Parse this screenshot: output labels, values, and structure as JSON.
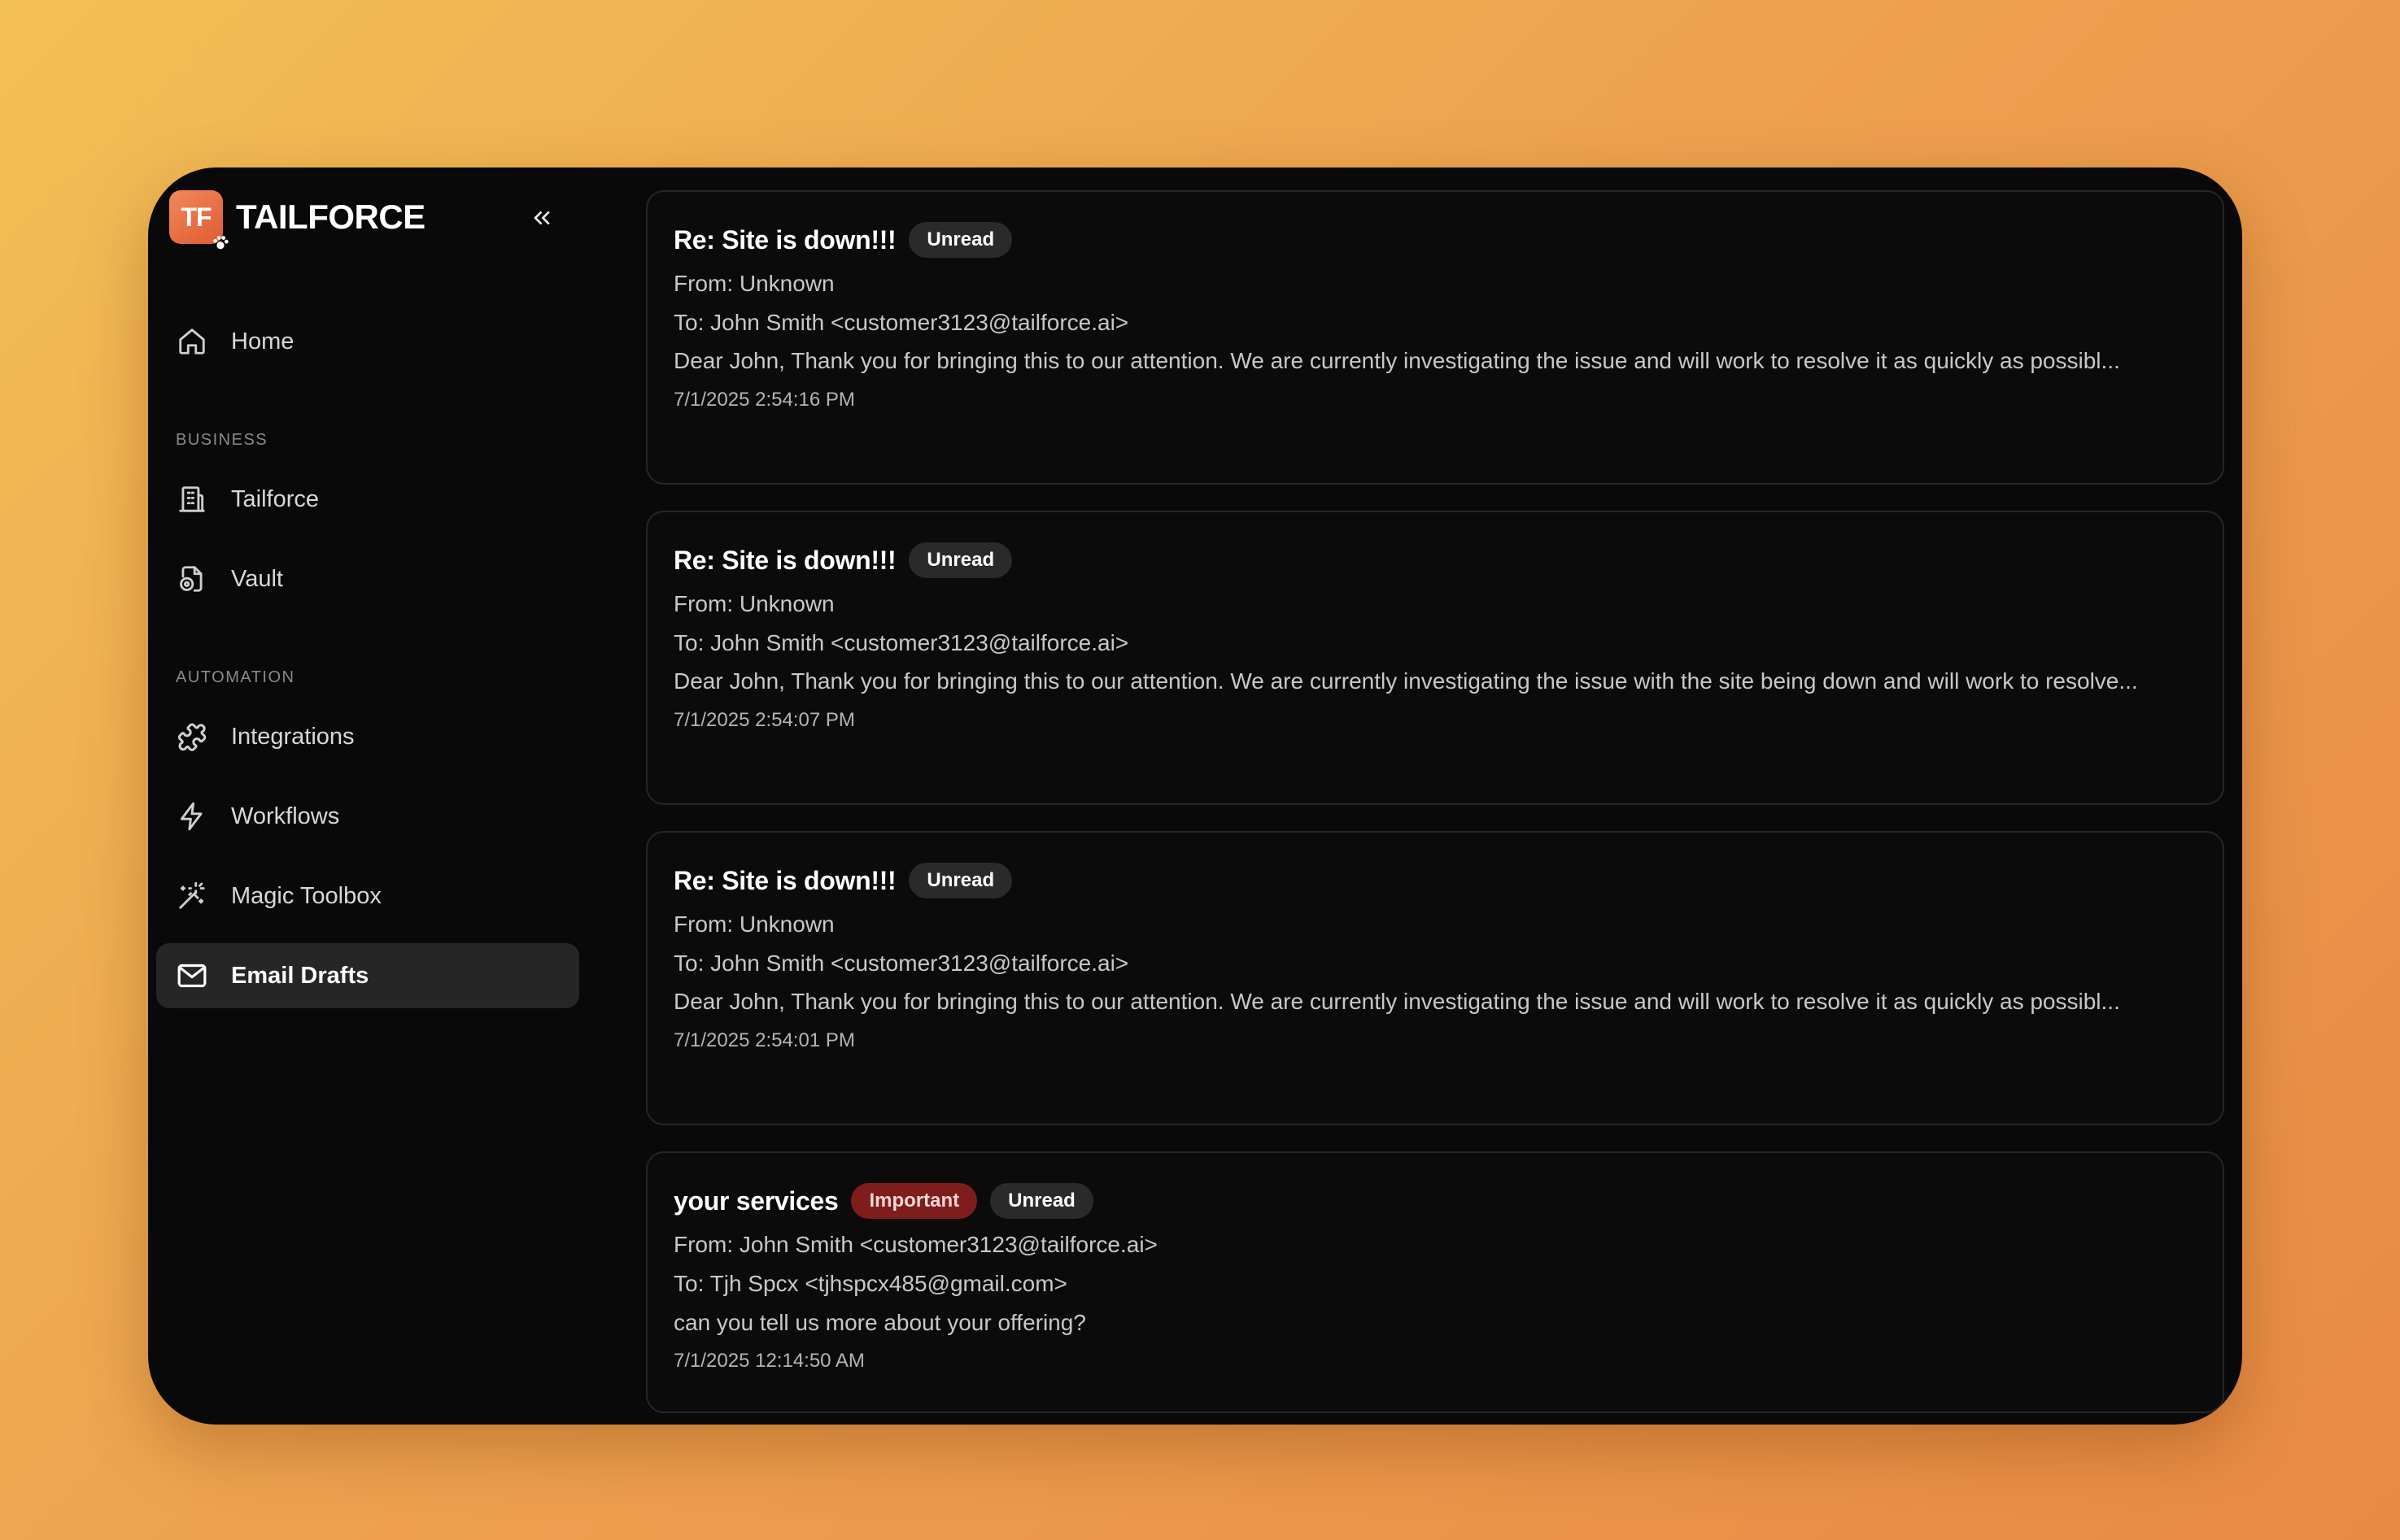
{
  "brand": {
    "logo_text": "TF",
    "name": "TAILFORCE"
  },
  "sidebar": {
    "collapse_icon": "chevrons-left-icon",
    "home": {
      "label": "Home",
      "icon": "home-icon"
    },
    "sections": [
      {
        "label": "BUSINESS",
        "items": [
          {
            "label": "Tailforce",
            "icon": "building-icon"
          },
          {
            "label": "Vault",
            "icon": "file-vault-icon"
          }
        ]
      },
      {
        "label": "AUTOMATION",
        "items": [
          {
            "label": "Integrations",
            "icon": "puzzle-icon"
          },
          {
            "label": "Workflows",
            "icon": "lightning-icon"
          },
          {
            "label": "Magic Toolbox",
            "icon": "magic-wand-icon"
          },
          {
            "label": "Email Drafts",
            "icon": "mail-icon",
            "active": true
          }
        ]
      }
    ]
  },
  "emails": [
    {
      "subject": "Re: Site is down!!!",
      "badges": [
        "Unread"
      ],
      "from": "From: Unknown",
      "to": "To: John Smith <customer3123@tailforce.ai>",
      "body": "Dear John, Thank you for bringing this to our attention. We are currently investigating the issue and will work to resolve it as quickly as possibl...",
      "timestamp": "7/1/2025 2:54:16 PM"
    },
    {
      "subject": "Re: Site is down!!!",
      "badges": [
        "Unread"
      ],
      "from": "From: Unknown",
      "to": "To: John Smith <customer3123@tailforce.ai>",
      "body": "Dear John, Thank you for bringing this to our attention. We are currently investigating the issue with the site being down and will work to resolve...",
      "timestamp": "7/1/2025 2:54:07 PM"
    },
    {
      "subject": "Re: Site is down!!!",
      "badges": [
        "Unread"
      ],
      "from": "From: Unknown",
      "to": "To: John Smith <customer3123@tailforce.ai>",
      "body": "Dear John, Thank you for bringing this to our attention. We are currently investigating the issue and will work to resolve it as quickly as possibl...",
      "timestamp": "7/1/2025 2:54:01 PM"
    },
    {
      "subject": "your services",
      "badges": [
        "Important",
        "Unread"
      ],
      "from": "From: John Smith <customer3123@tailforce.ai>",
      "to": "To: Tjh Spcx <tjhspcx485@gmail.com>",
      "body": "can you tell us more about your offering?",
      "timestamp": "7/1/2025 12:14:50 AM"
    }
  ],
  "colors": {
    "background_gradient": [
      "#f2bf55",
      "#e78a45"
    ],
    "window": "#090909",
    "logo": "#e05a33",
    "active_nav": "#262626",
    "badge": "#2a2a2a",
    "important_badge": "#7f1d1d"
  }
}
